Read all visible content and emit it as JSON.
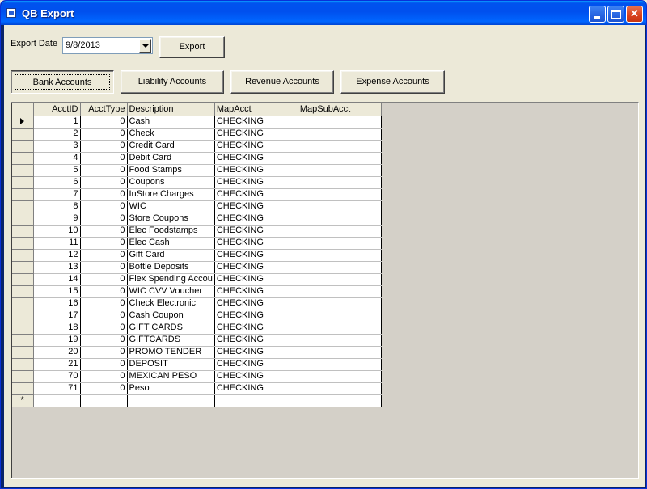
{
  "window": {
    "title": "QB Export"
  },
  "form": {
    "export_date_label": "Export Date",
    "export_date_value": "9/8/2013",
    "export_button": "Export"
  },
  "tabs": [
    {
      "label": "Bank Accounts",
      "selected": true
    },
    {
      "label": "Liability Accounts"
    },
    {
      "label": "Revenue Accounts"
    },
    {
      "label": "Expense Accounts"
    }
  ],
  "grid": {
    "columns": [
      "AcctID",
      "AcctType",
      "Description",
      "MapAcct",
      "MapSubAcct"
    ],
    "rows": [
      {
        "id": "1",
        "type": "0",
        "desc": "Cash",
        "map": "CHECKING",
        "sub": ""
      },
      {
        "id": "2",
        "type": "0",
        "desc": "Check",
        "map": "CHECKING",
        "sub": ""
      },
      {
        "id": "3",
        "type": "0",
        "desc": "Credit Card",
        "map": "CHECKING",
        "sub": ""
      },
      {
        "id": "4",
        "type": "0",
        "desc": "Debit Card",
        "map": "CHECKING",
        "sub": ""
      },
      {
        "id": "5",
        "type": "0",
        "desc": "Food Stamps",
        "map": "CHECKING",
        "sub": ""
      },
      {
        "id": "6",
        "type": "0",
        "desc": "Coupons",
        "map": "CHECKING",
        "sub": ""
      },
      {
        "id": "7",
        "type": "0",
        "desc": "InStore Charges",
        "map": "CHECKING",
        "sub": ""
      },
      {
        "id": "8",
        "type": "0",
        "desc": "WIC",
        "map": "CHECKING",
        "sub": ""
      },
      {
        "id": "9",
        "type": "0",
        "desc": "Store Coupons",
        "map": "CHECKING",
        "sub": ""
      },
      {
        "id": "10",
        "type": "0",
        "desc": "Elec Foodstamps",
        "map": "CHECKING",
        "sub": ""
      },
      {
        "id": "11",
        "type": "0",
        "desc": "Elec Cash",
        "map": "CHECKING",
        "sub": ""
      },
      {
        "id": "12",
        "type": "0",
        "desc": "Gift Card",
        "map": "CHECKING",
        "sub": ""
      },
      {
        "id": "13",
        "type": "0",
        "desc": "Bottle Deposits",
        "map": "CHECKING",
        "sub": ""
      },
      {
        "id": "14",
        "type": "0",
        "desc": "Flex Spending Accou",
        "map": "CHECKING",
        "sub": ""
      },
      {
        "id": "15",
        "type": "0",
        "desc": "WIC CVV Voucher",
        "map": "CHECKING",
        "sub": ""
      },
      {
        "id": "16",
        "type": "0",
        "desc": "Check Electronic",
        "map": "CHECKING",
        "sub": ""
      },
      {
        "id": "17",
        "type": "0",
        "desc": "Cash Coupon",
        "map": "CHECKING",
        "sub": ""
      },
      {
        "id": "18",
        "type": "0",
        "desc": "GIFT CARDS",
        "map": "CHECKING",
        "sub": ""
      },
      {
        "id": "19",
        "type": "0",
        "desc": "GIFTCARDS",
        "map": "CHECKING",
        "sub": ""
      },
      {
        "id": "20",
        "type": "0",
        "desc": "PROMO TENDER",
        "map": "CHECKING",
        "sub": ""
      },
      {
        "id": "21",
        "type": "0",
        "desc": "DEPOSIT",
        "map": "CHECKING",
        "sub": ""
      },
      {
        "id": "70",
        "type": "0",
        "desc": "MEXICAN PESO",
        "map": "CHECKING",
        "sub": ""
      },
      {
        "id": "71",
        "type": "0",
        "desc": "Peso",
        "map": "CHECKING",
        "sub": ""
      }
    ],
    "new_row_marker": "*",
    "current_row": 0
  },
  "icons": {
    "window": "app-icon",
    "minimize": "minimize-icon",
    "maximize": "maximize-icon",
    "close": "close-icon",
    "dropdown": "chevron-down-icon",
    "current_row": "row-pointer-icon"
  },
  "colors": {
    "titlebar": "#0053EE",
    "client": "#ECE9D8",
    "grid_empty": "#D4D0C8"
  }
}
